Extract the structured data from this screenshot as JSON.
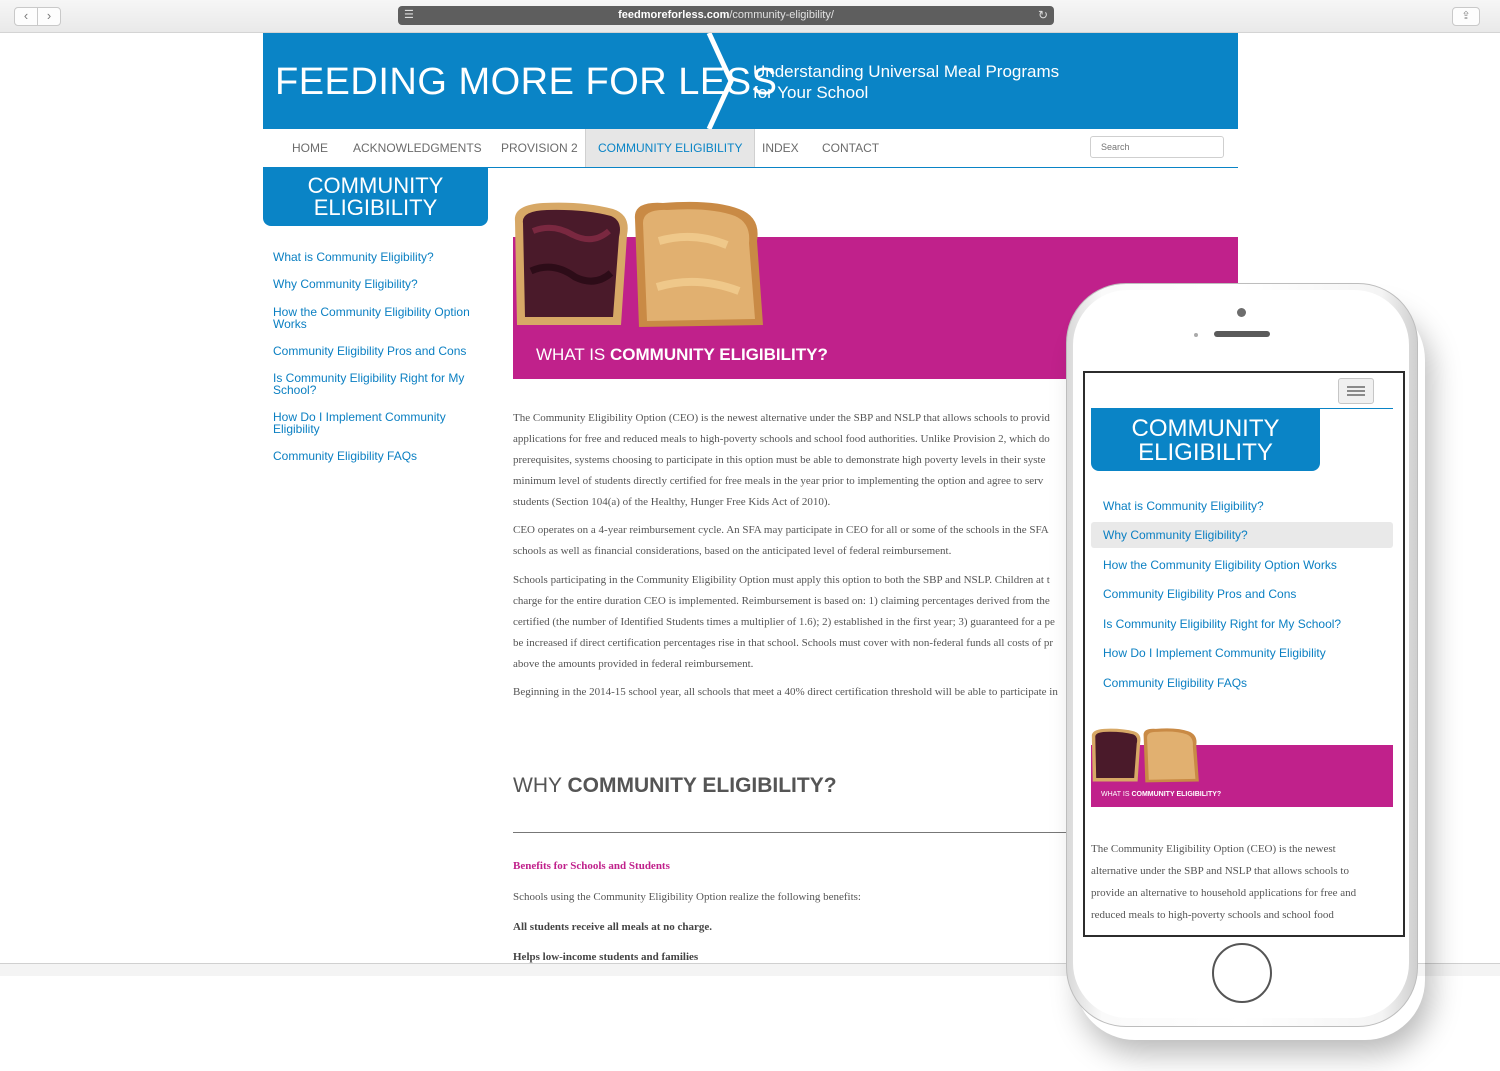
{
  "browser": {
    "url_host": "feedmoreforless.com",
    "url_path": "/community-eligibility/"
  },
  "site": {
    "title": "FEEDING MORE FOR LESS",
    "tagline_line1": "Understanding Universal Meal Programs",
    "tagline_line2": "for Your School"
  },
  "nav": {
    "items": [
      "HOME",
      "ACKNOWLEDGMENTS",
      "PROVISION 2",
      "COMMUNITY ELIGIBILITY",
      "INDEX",
      "CONTACT"
    ],
    "active": "COMMUNITY ELIGIBILITY",
    "search_placeholder": "Search"
  },
  "sidebar": {
    "heading_line1": "COMMUNITY",
    "heading_line2": "ELIGIBILITY",
    "links": [
      "What is Community Eligibility?",
      "Why Community Eligibility?",
      "How the Community Eligibility Option Works",
      "Community Eligibility Pros and Cons",
      "Is Community Eligibility Right for My School?",
      "How Do I Implement Community Eligibility",
      "Community Eligibility FAQs"
    ]
  },
  "hero": {
    "title_prefix": "WHAT IS ",
    "title_bold": "COMMUNITY ELIGIBILITY?",
    "color": "#c0218b"
  },
  "article": {
    "p1": [
      "The Community Eligibility Option (CEO) is the newest alternative under the SBP and NSLP that allows schools to provid",
      "applications for free and reduced meals to high-poverty schools and school food authorities. Unlike Provision 2, which do",
      "prerequisites, systems choosing to participate in this option must be able to demonstrate high poverty levels in their syste",
      "minimum level of students directly certified for free meals in the year prior to implementing the option and agree to serv",
      "students (Section 104(a) of the Healthy, Hunger Free Kids Act of 2010)."
    ],
    "p2": [
      "CEO operates on a 4-year reimbursement cycle. An SFA may participate in CEO for all or some of the schools in the SFA",
      "schools as well as financial considerations, based on the anticipated level of federal reimbursement."
    ],
    "p3": [
      "Schools participating in the Community Eligibility Option must apply this option to both the SBP and NSLP. Children at t",
      "charge for the entire duration CEO is implemented. Reimbursement is based on: 1) claiming percentages derived from the",
      "certified (the number of Identified Students times a multiplier of 1.6); 2) established in the first year; 3) guaranteed for a pe",
      "be increased if direct certification percentages rise in that school. Schools must cover with non-federal funds all costs of pr",
      "above the amounts provided in federal reimbursement."
    ],
    "p4": "Beginning in the 2014-15 school year, all schools that meet a 40% direct certification threshold will be able to participate in",
    "why_prefix": "WHY ",
    "why_bold": "COMMUNITY ELIGIBILITY?",
    "benefits_heading": "Benefits for Schools and Students",
    "benefits_intro": "Schools using the Community Eligibility Option realize the following benefits:",
    "benefit1": "All students receive all meals at no charge.",
    "benefit2": "Helps low-income students and families"
  },
  "mobile": {
    "heading_line1": "COMMUNITY",
    "heading_line2": "ELIGIBILITY",
    "links": [
      "What is Community Eligibility?",
      "Why Community Eligibility?",
      "How the Community Eligibility Option Works",
      "Community Eligibility Pros and Cons",
      "Is Community Eligibility Right for My School?",
      "How Do I Implement Community Eligibility",
      "Community Eligibility FAQs"
    ],
    "hovered": "Why Community Eligibility?",
    "hero_prefix": "WHAT IS ",
    "hero_bold": "COMMUNITY ELIGIBILITY?",
    "para": [
      "The Community Eligibility Option (CEO) is the newest",
      "alternative under the SBP and NSLP that allows schools to",
      "provide an alternative to household applications for free and",
      "reduced meals to high-poverty schools and school food"
    ]
  },
  "colors": {
    "brand_blue": "#0a84c6",
    "accent_magenta": "#c0218b"
  }
}
